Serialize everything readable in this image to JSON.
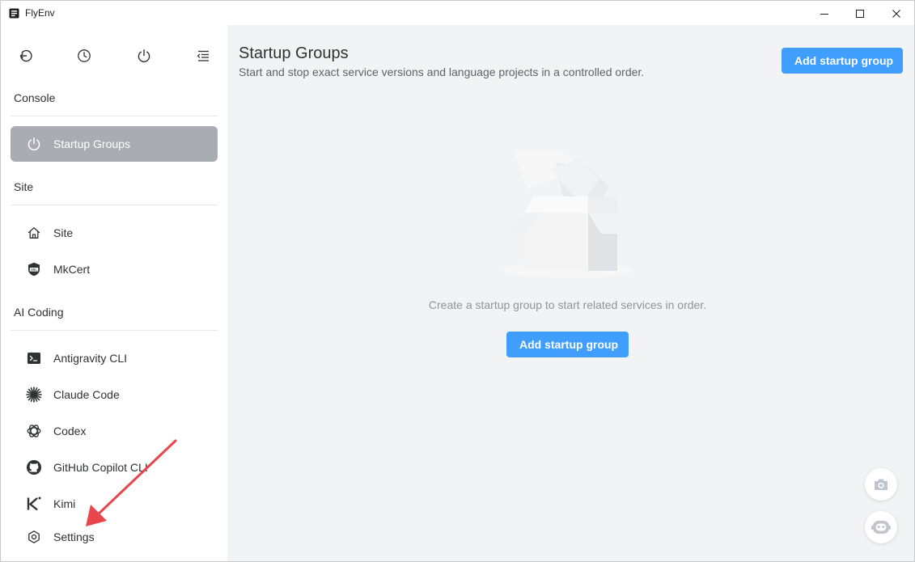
{
  "window": {
    "title": "FlyEnv"
  },
  "sidebar": {
    "top_icons": [
      "back-icon",
      "history-icon",
      "power-icon",
      "collapse-menu-icon"
    ],
    "sections": [
      {
        "label": "Console"
      },
      {
        "label": "Site"
      },
      {
        "label": "AI Coding"
      }
    ],
    "items": [
      {
        "label": "Startup Groups",
        "icon": "power-icon",
        "active": true
      },
      {
        "label": "Site",
        "icon": "home-icon"
      },
      {
        "label": "MkCert",
        "icon": "ssl-certificate-icon"
      },
      {
        "label": "Antigravity CLI",
        "icon": "terminal-icon"
      },
      {
        "label": "Claude Code",
        "icon": "claude-sparkle-icon"
      },
      {
        "label": "Codex",
        "icon": "openai-icon"
      },
      {
        "label": "GitHub Copilot CLI",
        "icon": "github-icon"
      },
      {
        "label": "Kimi",
        "icon": "kimi-icon"
      },
      {
        "label": "Settings",
        "icon": "gear-icon"
      }
    ]
  },
  "main": {
    "title": "Startup Groups",
    "subtitle": "Start and stop exact service versions and language projects in a controlled order.",
    "add_button_label": "Add startup group",
    "empty_text": "Create a startup group to start related services in order.",
    "empty_button_label": "Add startup group"
  },
  "colors": {
    "primary": "#409eff",
    "active_item": "#a9adb3",
    "main_bg": "#f2f3f5",
    "annotation_arrow": "#e8464a"
  }
}
